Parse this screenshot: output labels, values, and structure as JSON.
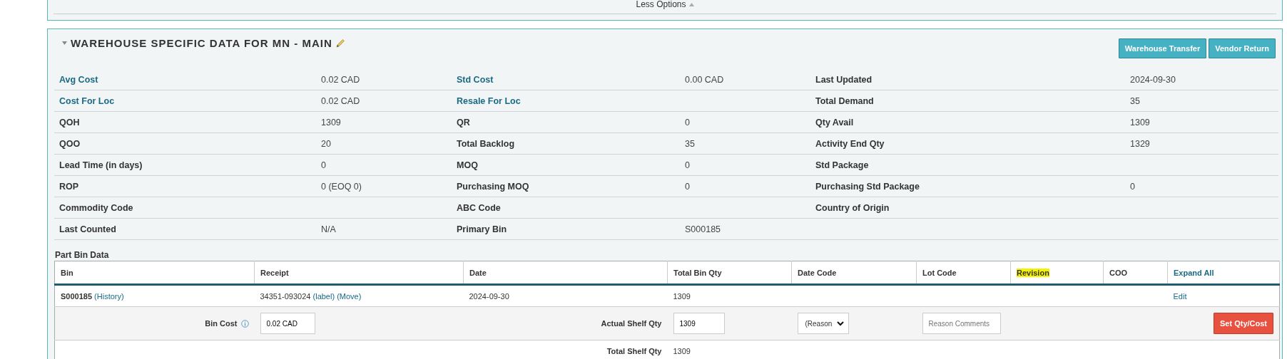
{
  "options_panel": {
    "toggle_label": "Less Options",
    "expanded": true
  },
  "warehouse": {
    "title": "WAREHOUSE SPECIFIC DATA FOR MN - MAIN",
    "expanded": true,
    "buttons": [
      "Warehouse Transfer",
      "Vendor Return"
    ],
    "fields": [
      [
        {
          "label": "Avg Cost",
          "kind": "link",
          "value": "0.02 CAD"
        },
        {
          "label": "Std Cost",
          "kind": "link",
          "value": "0.00 CAD"
        },
        {
          "label": "Last Updated",
          "kind": "plain",
          "value": "2024-09-30"
        }
      ],
      [
        {
          "label": "Cost For Loc",
          "kind": "link",
          "value": "0.02 CAD"
        },
        {
          "label": "Resale For Loc",
          "kind": "link"
        },
        {
          "label": "Total Demand",
          "kind": "plain",
          "value": "35"
        }
      ],
      [
        {
          "label": "QOH",
          "kind": "plain",
          "value": "1309"
        },
        {
          "label": "QR",
          "kind": "plain",
          "value": "0"
        },
        {
          "label": "Qty Avail",
          "kind": "plain",
          "value": "1309"
        }
      ],
      [
        {
          "label": "QOO",
          "kind": "plain",
          "value": "20"
        },
        {
          "label": "Total Backlog",
          "kind": "plain",
          "value": "35"
        },
        {
          "label": "Activity End Qty",
          "kind": "plain",
          "value": "1329"
        }
      ],
      [
        {
          "label": "Lead Time (in days)",
          "kind": "plain",
          "value": "0"
        },
        {
          "label": "MOQ",
          "kind": "plain",
          "value": "0"
        },
        {
          "label": "Std Package",
          "kind": "plain"
        }
      ],
      [
        {
          "label": "ROP",
          "kind": "plain",
          "value": "0 (EOQ 0)"
        },
        {
          "label": "Purchasing MOQ",
          "kind": "plain",
          "value": "0"
        },
        {
          "label": "Purchasing Std Package",
          "kind": "plain",
          "value": "0"
        }
      ],
      [
        {
          "label": "Commodity Code",
          "kind": "plain"
        },
        {
          "label": "ABC Code",
          "kind": "plain"
        },
        {
          "label": "Country of Origin",
          "kind": "plain"
        }
      ],
      [
        {
          "label": "Last Counted",
          "kind": "plain",
          "value": "N/A"
        },
        {
          "label": "Primary Bin",
          "kind": "plain",
          "value": "S000185"
        }
      ]
    ]
  },
  "part_bin": {
    "title": "Part Bin Data",
    "columns": [
      {
        "label": "Bin",
        "kind": "text",
        "highlighted": false
      },
      {
        "label": "Receipt",
        "kind": "text",
        "highlighted": false
      },
      {
        "label": "Date",
        "kind": "text",
        "highlighted": false
      },
      {
        "label": "Total Bin Qty",
        "kind": "text",
        "highlighted": false
      },
      {
        "label": "Date Code",
        "kind": "text",
        "highlighted": false
      },
      {
        "label": "Lot Code",
        "kind": "text",
        "highlighted": false
      },
      {
        "label": "Revision",
        "kind": "text",
        "highlighted": true
      },
      {
        "label": "COO",
        "kind": "text",
        "highlighted": false
      },
      {
        "label": "Expand All",
        "kind": "link",
        "highlighted": false
      }
    ],
    "rows": [
      {
        "bin": "S000185",
        "history_link": "(History)",
        "receipt": "34351-093024",
        "receipt_links": [
          "(label)",
          "(Move)"
        ],
        "date": "2024-09-30",
        "total_bin_qty": "1309",
        "action": "Edit"
      }
    ],
    "edit_row": {
      "bin_cost_label": "Bin Cost",
      "bin_cost_value": "0.02 CAD",
      "shelf_qty_label": "Actual Shelf Qty",
      "shelf_qty_value": "1309",
      "reason_select": "(Reason",
      "comments_placeholder": "Reason Comments",
      "submit": "Set Qty/Cost"
    },
    "total": {
      "label": "Total Shelf Qty",
      "value": "1309"
    }
  }
}
